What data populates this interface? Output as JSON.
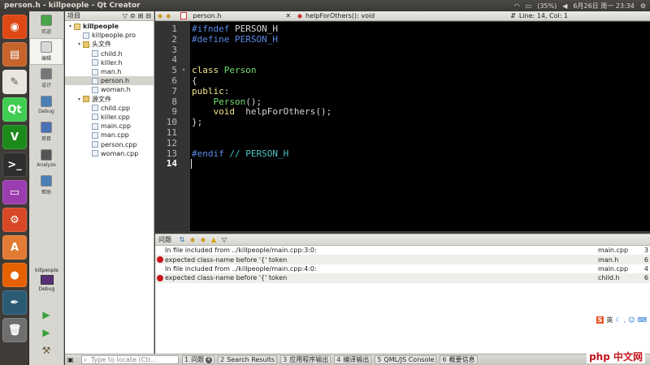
{
  "window": {
    "title": "person.h - killpeople - Qt Creator",
    "battery": "(35%)",
    "clock": "6月26日 周一 23:34"
  },
  "launcher": {
    "items": [
      {
        "name": "ubuntu-logo-icon",
        "color": "#dd4814",
        "glyph": "◉"
      },
      {
        "name": "files-icon",
        "color": "#c6642c",
        "glyph": "▤"
      },
      {
        "name": "text-editor-icon",
        "color": "#e9e6df",
        "glyph": "✎"
      },
      {
        "name": "qt-creator-icon",
        "color": "#41cd52",
        "glyph": "Qt"
      },
      {
        "name": "vim-icon",
        "color": "#1b8a1b",
        "glyph": "V"
      },
      {
        "name": "terminal-icon",
        "color": "#2e2e2e",
        "glyph": ">_"
      },
      {
        "name": "workspace-icon",
        "color": "#9b3dae",
        "glyph": "▭"
      },
      {
        "name": "system-settings-icon",
        "color": "#d84826",
        "glyph": "⚙"
      },
      {
        "name": "software-center-icon",
        "color": "#e27b33",
        "glyph": "A"
      },
      {
        "name": "firefox-icon",
        "color": "#e66000",
        "glyph": "●"
      },
      {
        "name": "inkscape-icon",
        "color": "#2b5a74",
        "glyph": "✒"
      },
      {
        "name": "trash-icon",
        "color": "#6f6f6f",
        "glyph": "🗑"
      }
    ]
  },
  "modes": [
    {
      "label": "欢迎",
      "name": "mode-welcome",
      "color": "#47a447"
    },
    {
      "label": "编辑",
      "name": "mode-edit",
      "color": "#d9d9d9",
      "selected": true
    },
    {
      "label": "设计",
      "name": "mode-design",
      "color": "#777777"
    },
    {
      "label": "Debug",
      "name": "mode-debug",
      "color": "#4a7fb5"
    },
    {
      "label": "项目",
      "name": "mode-projects",
      "color": "#4a70b5"
    },
    {
      "label": "Analyze",
      "name": "mode-analyze",
      "color": "#555555"
    },
    {
      "label": "帮助",
      "name": "mode-help",
      "color": "#4a7fb5"
    }
  ],
  "target": {
    "project": "killpeople",
    "config": "Debug"
  },
  "project_panel": {
    "header": "项目",
    "tree": [
      {
        "label": "killpeople",
        "depth": 0,
        "arrow": "▾",
        "kind": "proj",
        "bold": true
      },
      {
        "label": "killpeople.pro",
        "depth": 1,
        "arrow": "",
        "kind": "file"
      },
      {
        "label": "头文件",
        "depth": 1,
        "arrow": "▾",
        "kind": "folder"
      },
      {
        "label": "child.h",
        "depth": 2,
        "arrow": "",
        "kind": "file"
      },
      {
        "label": "killer.h",
        "depth": 2,
        "arrow": "",
        "kind": "file"
      },
      {
        "label": "man.h",
        "depth": 2,
        "arrow": "",
        "kind": "file"
      },
      {
        "label": "person.h",
        "depth": 2,
        "arrow": "",
        "kind": "file",
        "selected": true
      },
      {
        "label": "woman.h",
        "depth": 2,
        "arrow": "",
        "kind": "file"
      },
      {
        "label": "源文件",
        "depth": 1,
        "arrow": "▾",
        "kind": "folder"
      },
      {
        "label": "child.cpp",
        "depth": 2,
        "arrow": "",
        "kind": "file"
      },
      {
        "label": "killer.cpp",
        "depth": 2,
        "arrow": "",
        "kind": "file"
      },
      {
        "label": "main.cpp",
        "depth": 2,
        "arrow": "",
        "kind": "file"
      },
      {
        "label": "man.cpp",
        "depth": 2,
        "arrow": "",
        "kind": "file"
      },
      {
        "label": "person.cpp",
        "depth": 2,
        "arrow": "",
        "kind": "file"
      },
      {
        "label": "woman.cpp",
        "depth": 2,
        "arrow": "",
        "kind": "file"
      }
    ]
  },
  "editor_header": {
    "file": "person.h",
    "symbol": "helpForOthers(): void",
    "position": "Line: 14, Col: 1"
  },
  "editor": {
    "current_line": 14,
    "lines": [
      {
        "n": "1",
        "parts": [
          {
            "t": "#ifndef",
            "c": "#5c8ae6"
          },
          {
            "t": " PERSON_H",
            "c": "#d6d6d6"
          }
        ]
      },
      {
        "n": "2",
        "parts": [
          {
            "t": "#define",
            "c": "#5c8ae6"
          },
          {
            "t": " PERSON_H",
            "c": "#5c8ae6"
          }
        ]
      },
      {
        "n": "3",
        "parts": []
      },
      {
        "n": "4",
        "parts": []
      },
      {
        "n": "5",
        "parts": [
          {
            "t": "class",
            "c": "#f0e68c"
          },
          {
            "t": " Person",
            "c": "#6ee06e"
          }
        ],
        "fold": true
      },
      {
        "n": "6",
        "parts": [
          {
            "t": "{",
            "c": "#d6d6d6"
          }
        ]
      },
      {
        "n": "7",
        "parts": [
          {
            "t": "public",
            "c": "#f0e68c"
          },
          {
            "t": ":",
            "c": "#d6d6d6"
          }
        ]
      },
      {
        "n": "8",
        "parts": [
          {
            "t": "    Person",
            "c": "#6ee06e"
          },
          {
            "t": "();",
            "c": "#d6d6d6"
          }
        ]
      },
      {
        "n": "9",
        "parts": [
          {
            "t": "    void",
            "c": "#f0e68c"
          },
          {
            "t": "  helpForOthers();",
            "c": "#d6d6d6"
          }
        ]
      },
      {
        "n": "10",
        "parts": [
          {
            "t": "};",
            "c": "#d6d6d6"
          }
        ]
      },
      {
        "n": "11",
        "parts": []
      },
      {
        "n": "12",
        "parts": []
      },
      {
        "n": "13",
        "parts": [
          {
            "t": "#endif",
            "c": "#5c8ae6"
          },
          {
            "t": " // PERSON_H",
            "c": "#4fc3c3"
          }
        ]
      },
      {
        "n": "14",
        "parts": []
      }
    ]
  },
  "issues": {
    "title": "问题",
    "rows": [
      {
        "type": "info",
        "message": "In file included from ../killpeople/main.cpp:3:0:",
        "file": "main.cpp",
        "line": "3"
      },
      {
        "type": "error",
        "message": "expected class-name before '{' token",
        "file": "man.h",
        "line": "6"
      },
      {
        "type": "info",
        "message": "In file included from ../killpeople/main.cpp:4:0:",
        "file": "main.cpp",
        "line": "4"
      },
      {
        "type": "error",
        "message": "expected class-name before '{' token",
        "file": "child.h",
        "line": "6"
      }
    ]
  },
  "input_method": {
    "label": "英"
  },
  "locator": {
    "placeholder": "Type to locate (Ctr..."
  },
  "output_panes": [
    {
      "num": "1",
      "label": "问题",
      "badge": "4"
    },
    {
      "num": "2",
      "label": "Search Results"
    },
    {
      "num": "3",
      "label": "应用程序输出"
    },
    {
      "num": "4",
      "label": "编译输出"
    },
    {
      "num": "5",
      "label": "QML/JS Console"
    },
    {
      "num": "6",
      "label": "概要信息"
    }
  ],
  "watermark": "php 中文网"
}
